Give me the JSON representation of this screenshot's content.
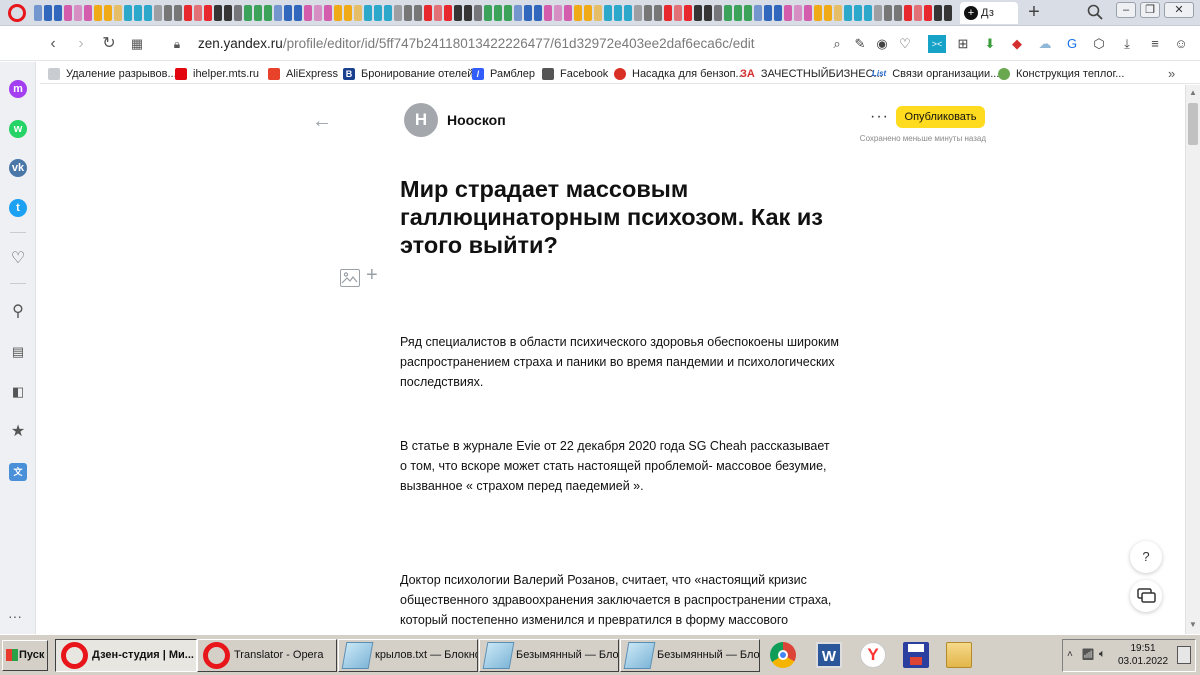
{
  "browser": {
    "active_tab_label": "Дз",
    "url_host": "zen.yandex.ru",
    "url_path": "/profile/editor/id/5ff747b24118013422226477/61d32972e403ee2daf6eca6c/edit",
    "bookmarks": [
      {
        "label": "Удаление разрывов...",
        "icon": "page-icon",
        "color": "#7a7a7a"
      },
      {
        "label": "ihelper.mts.ru",
        "icon": "mts-icon",
        "color": "#e30611"
      },
      {
        "label": "AliExpress",
        "icon": "aliexpress-icon",
        "color": "#e8422a"
      },
      {
        "label": "Бронирование отелей",
        "icon": "booking-icon",
        "color": "#1b3f8f"
      },
      {
        "label": "Рамблер",
        "icon": "rambler-icon",
        "color": "#315efb"
      },
      {
        "label": "Facebook",
        "icon": "facebook-icon",
        "color": "#555555"
      },
      {
        "label": "Насадка для бензоп...",
        "icon": "pin-icon",
        "color": "#d93025"
      },
      {
        "label": "ЗАЧЕСТНЫЙБИЗНЕС...",
        "icon": "za-icon",
        "color": "#d32f2f",
        "prefix": "ЗА"
      },
      {
        "label": "Связи организации...",
        "icon": "list-org-icon",
        "color": "#1e63c4",
        "prefix": "List"
      },
      {
        "label": "Конструкция теплог...",
        "icon": "link-icon",
        "color": "#6aa84f"
      }
    ],
    "bookmarks_more": "»"
  },
  "editor": {
    "channel_initial": "Н",
    "channel_name": "Нооскоп",
    "more_label": "···",
    "publish_label": "Опубликовать",
    "saved_status": "Сохранено меньше минуты назад",
    "title": "Мир страдает массовым галлюцинаторным психозом. Как из этого выйти?",
    "paragraphs": [
      "Ряд специалистов в области психического здоровья обеспокоены широким распространением страха и паники во время пандемии и психологических последствиях.",
      "В статье в журнале Evie от 22 декабря 2020 года SG Cheah рассказывает о том, что вскоре может стать настоящей проблемой- массовое безумие, вызванное « страхом перед паедемией ».",
      "Доктор психологии Валерий Розанов, считает, что «настоящий кризис общественного здравоохранения заключается в распространении страха, который постепенно изменился и превратился в форму массового"
    ],
    "help_label": "?"
  },
  "taskbar": {
    "start_label": "Пуск",
    "tasks": [
      {
        "label": "Дзен-студия | Ми...",
        "icon": "opera-icon",
        "active": true
      },
      {
        "label": "Translator - Opera",
        "icon": "opera-icon",
        "active": false
      },
      {
        "label": "крылов.txt — Блокнот",
        "icon": "notepad-icon",
        "active": false
      },
      {
        "label": "Безымянный — Блок...",
        "icon": "notepad-icon",
        "active": false
      },
      {
        "label": "Безымянный — Блок...",
        "icon": "notepad-icon",
        "active": false
      }
    ],
    "time": "19:51",
    "date": "03.01.2022"
  },
  "colors": {
    "accent_yellow": "#ffdb1f",
    "opera_red": "#e8151b",
    "taskbar_gray": "#d4d0c8"
  }
}
